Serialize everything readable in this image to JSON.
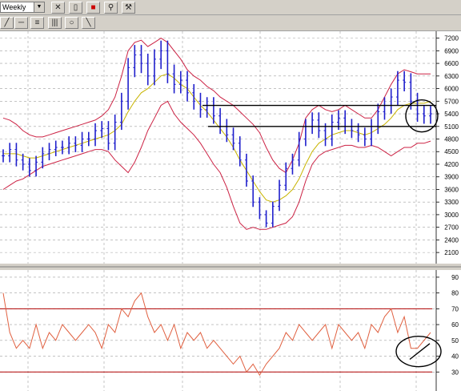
{
  "toolbar": {
    "period_value": "Weekly",
    "icons": [
      "compare-icon",
      "new-icon",
      "color-icon",
      "zoom-icon",
      "tools-icon",
      "trendline-icon",
      "hline-icon",
      "list-icon",
      "columns-icon",
      "ellipse-icon",
      "pencil-icon"
    ]
  },
  "colors": {
    "background": "#ffffff",
    "grid": "#a0a0a0",
    "candle": "#1f1fcc",
    "bollinger": "#cc2244",
    "sma": "#c8b400",
    "rsi": "#e06040",
    "rsi_levels": "#b00000",
    "annotation": "#000000"
  },
  "chart_data": [
    {
      "type": "candlestick",
      "title": "",
      "period": "Weekly",
      "y_ticks": [
        2100,
        2400,
        2700,
        3000,
        3300,
        3600,
        3900,
        4200,
        4500,
        4800,
        5100,
        5400,
        5700,
        6000,
        6300,
        6600,
        6900,
        7200
      ],
      "ylim": [
        1950,
        7250
      ],
      "series": [
        {
          "name": "close",
          "values": [
            4400,
            4550,
            4300,
            4200,
            4050,
            4250,
            4450,
            4550,
            4600,
            4600,
            4700,
            4650,
            4800,
            4800,
            5000,
            5050,
            4700,
            5200,
            5700,
            6500,
            6800,
            6600,
            6300,
            6700,
            6900,
            6350,
            6100,
            6200,
            5900,
            5700,
            5500,
            5600,
            5350,
            5100,
            4900,
            4700,
            4300,
            3800,
            3300,
            3000,
            2800,
            3200,
            3700,
            4100,
            4300,
            4800,
            5100,
            5250,
            5000,
            4800,
            5200,
            5300,
            5100,
            5000,
            4900,
            4800,
            5100,
            5450,
            5600,
            5800,
            6200,
            6150,
            5700,
            5400,
            5350,
            5400
          ]
        },
        {
          "name": "upper_band",
          "values": [
            5300,
            5250,
            5150,
            5000,
            4900,
            4850,
            4850,
            4900,
            4950,
            5000,
            5050,
            5100,
            5150,
            5200,
            5250,
            5350,
            5500,
            5800,
            6300,
            6900,
            7100,
            7150,
            7000,
            7100,
            7200,
            7100,
            6900,
            6700,
            6450,
            6300,
            6200,
            6050,
            5950,
            5800,
            5700,
            5600,
            5450,
            5300,
            5150,
            4950,
            4600,
            4300,
            4100,
            4000,
            4300,
            4700,
            5300,
            5500,
            5600,
            5500,
            5450,
            5500,
            5600,
            5500,
            5400,
            5300,
            5300,
            5500,
            5800,
            6100,
            6350,
            6450,
            6400,
            6350,
            6350,
            6350
          ]
        },
        {
          "name": "lower_band",
          "values": [
            3600,
            3700,
            3800,
            3850,
            3950,
            4050,
            4150,
            4200,
            4250,
            4300,
            4350,
            4400,
            4450,
            4500,
            4550,
            4550,
            4500,
            4300,
            4150,
            4000,
            4250,
            4600,
            5000,
            5300,
            5600,
            5700,
            5400,
            5200,
            5050,
            4900,
            4700,
            4450,
            4200,
            4000,
            3650,
            3200,
            2800,
            2650,
            2700,
            2650,
            2650,
            2700,
            2750,
            2800,
            2950,
            3300,
            3800,
            4200,
            4400,
            4500,
            4550,
            4600,
            4650,
            4650,
            4600,
            4600,
            4650,
            4600,
            4500,
            4400,
            4500,
            4600,
            4600,
            4700,
            4700,
            4750
          ]
        },
        {
          "name": "sma",
          "values": [
            4450,
            4450,
            4450,
            4400,
            4350,
            4350,
            4400,
            4450,
            4500,
            4550,
            4600,
            4650,
            4700,
            4750,
            4800,
            4850,
            4900,
            5000,
            5150,
            5450,
            5700,
            5900,
            6000,
            6150,
            6300,
            6350,
            6250,
            6100,
            6000,
            5800,
            5600,
            5450,
            5250,
            5050,
            4850,
            4600,
            4300,
            4050,
            3800,
            3550,
            3350,
            3300,
            3350,
            3450,
            3600,
            3850,
            4200,
            4500,
            4700,
            4800,
            4900,
            4950,
            5000,
            5000,
            4950,
            4900,
            4950,
            5050,
            5150,
            5300,
            5500,
            5600,
            5650,
            5650,
            5650,
            5700
          ]
        }
      ],
      "annotations": {
        "resistance": 5600,
        "support": 5100
      }
    },
    {
      "type": "line",
      "title": "",
      "y_ticks": [
        30,
        40,
        50,
        60,
        70,
        80,
        90
      ],
      "ylim": [
        20,
        92
      ],
      "series": [
        {
          "name": "RSI",
          "values": [
            80,
            55,
            45,
            50,
            45,
            60,
            45,
            55,
            50,
            60,
            55,
            50,
            55,
            60,
            55,
            45,
            60,
            55,
            70,
            65,
            75,
            80,
            65,
            55,
            60,
            50,
            60,
            45,
            55,
            50,
            55,
            45,
            50,
            45,
            40,
            35,
            40,
            30,
            35,
            28,
            35,
            40,
            45,
            55,
            50,
            60,
            55,
            50,
            55,
            60,
            45,
            60,
            55,
            50,
            55,
            45,
            60,
            55,
            65,
            70,
            55,
            65,
            45,
            45,
            50,
            55
          ]
        }
      ],
      "levels": [
        70,
        30
      ]
    }
  ]
}
